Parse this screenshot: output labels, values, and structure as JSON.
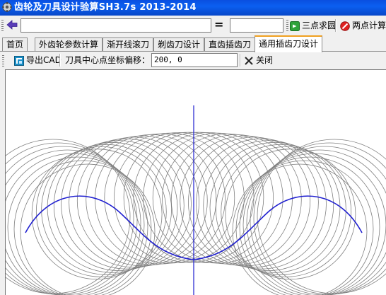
{
  "window": {
    "title": "齿轮及刀具设计验算SH3.7s 2013-2014"
  },
  "toolbar": {
    "main_input_value": "",
    "equals_label": "=",
    "result_input_value": "",
    "three_point_label": "三点求圆",
    "two_point_label": "两点计算"
  },
  "tabs": [
    {
      "label": "首页"
    },
    {
      "label": "外齿轮参数计算"
    },
    {
      "label": "渐开线滚刀"
    },
    {
      "label": "剃齿刀设计"
    },
    {
      "label": "直齿插齿刀"
    },
    {
      "label": "通用插齿刀设计",
      "active": true
    }
  ],
  "subtoolbar": {
    "export_label": "导出CAD",
    "offset_label": "刀具中心点坐标偏移：",
    "offset_value": "200, 0",
    "close_label": "关闭"
  },
  "colors": {
    "title_bar": "#0b5ff0",
    "profile_blue": "#2020d0",
    "cutter_gray": "#808080",
    "active_tab_accent": "#f0a020"
  },
  "icons": {
    "back": "arrow-left-icon",
    "three_point": "green-plus-icon",
    "two_point": "red-no-icon",
    "export": "export-cad-icon",
    "close": "x-icon"
  }
}
